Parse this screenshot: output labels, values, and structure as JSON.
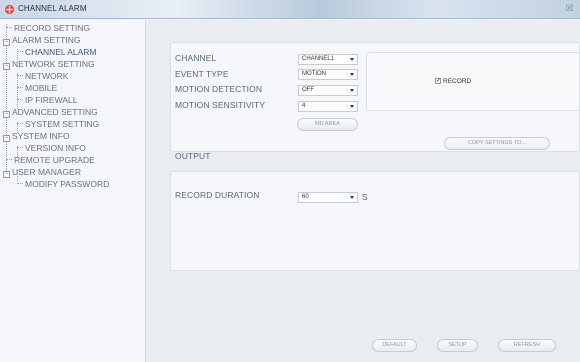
{
  "window": {
    "title": "CHANNEL ALARM",
    "close_icon": "close-icon",
    "close_symbol": "☒"
  },
  "sidebar": {
    "items": [
      {
        "label": "RECORD SETTING"
      },
      {
        "label": "ALARM SETTING"
      },
      {
        "label": "CHANNEL ALARM"
      },
      {
        "label": "NETWORK SETTING"
      },
      {
        "label": "NETWORK"
      },
      {
        "label": "MOBILE"
      },
      {
        "label": "IP FIREWALL"
      },
      {
        "label": "ADVANCED SETTING"
      },
      {
        "label": "SYSTEM SETTING"
      },
      {
        "label": "SYSTEM INFO"
      },
      {
        "label": "VERSION INFO"
      },
      {
        "label": "REMOTE UPGRADE"
      },
      {
        "label": "USER MANAGER"
      },
      {
        "label": "MODIFY PASSWORD"
      }
    ]
  },
  "alarm": {
    "channel_label": "CHANNEL",
    "channel_value": "CHANNEL1",
    "event_type_label": "EVENT TYPE",
    "event_type_value": "MOTION",
    "motion_detection_label": "MOTION DETECTION",
    "motion_detection_value": "OFF",
    "motion_sensitivity_label": "MOTION  SENSITIVITY",
    "motion_sensitivity_value": "4",
    "md_area_button": "MD AREA",
    "record_checkbox_label": "RECORD",
    "record_checked": true,
    "check_mark": "✓",
    "copy_settings_button": "COPY SETTINGS TO..."
  },
  "output": {
    "section_title": "OUTPUT",
    "record_duration_label": "RECORD DURATION",
    "record_duration_value": "60",
    "unit": "S"
  },
  "footer": {
    "default_button": "DEFAULT",
    "setup_button": "SETUP",
    "refresh_button": "REFRESH"
  }
}
